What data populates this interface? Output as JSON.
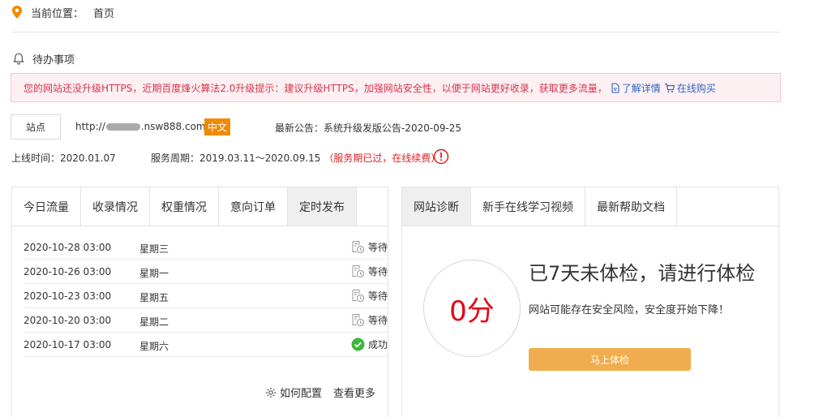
{
  "breadcrumb": {
    "label": "当前位置：",
    "current": "首页"
  },
  "todo": {
    "title": "待办事项"
  },
  "notice": {
    "text": "您的网站还没升级HTTPS，近期百度烽火算法2.0升级提示：建议升级HTTPS，加强网站安全性，以便于网站更好收录，获取更多流量，",
    "detail_link": "了解详情",
    "buy_link": "在线购买"
  },
  "site": {
    "button": "站点",
    "url_prefix": "http://",
    "url_suffix": ".nsw888.com",
    "lang": "中文",
    "announcement": "最新公告：系统升级发版公告-2020-09-25"
  },
  "service": {
    "online_time": "上线时间：2020.01.07",
    "period": "服务周期：2019.03.11～2020.09.15",
    "expired_note": "（服务期已过，在线续费）"
  },
  "left_panel": {
    "tabs": [
      "今日流量",
      "收录情况",
      "权重情况",
      "意向订单",
      "定时发布"
    ],
    "active_tab": 4,
    "rows": [
      {
        "date": "2020-10-28 03:00",
        "week": "星期三",
        "status": "等待",
        "state": "waiting"
      },
      {
        "date": "2020-10-26 03:00",
        "week": "星期一",
        "status": "等待",
        "state": "waiting"
      },
      {
        "date": "2020-10-23 03:00",
        "week": "星期五",
        "status": "等待",
        "state": "waiting"
      },
      {
        "date": "2020-10-20 03:00",
        "week": "星期二",
        "status": "等待",
        "state": "waiting"
      },
      {
        "date": "2020-10-17 03:00",
        "week": "星期六",
        "status": "成功",
        "state": "success"
      }
    ],
    "config_link": "如何配置",
    "more_link": "查看更多"
  },
  "right_panel": {
    "tabs": [
      "网站诊断",
      "新手在线学习视频",
      "最新帮助文档"
    ],
    "active_tab": 0,
    "score": "0分",
    "title": "已7天未体检，请进行体检",
    "subtitle": "网站可能存在安全风险，安全度开始下降！",
    "button": "马上体检"
  },
  "colors": {
    "accent_orange": "#f08a00",
    "button_orange": "#f0ad4e",
    "danger_red": "#e02020",
    "link_blue": "#2d66c8",
    "success_green": "#3db83d"
  }
}
